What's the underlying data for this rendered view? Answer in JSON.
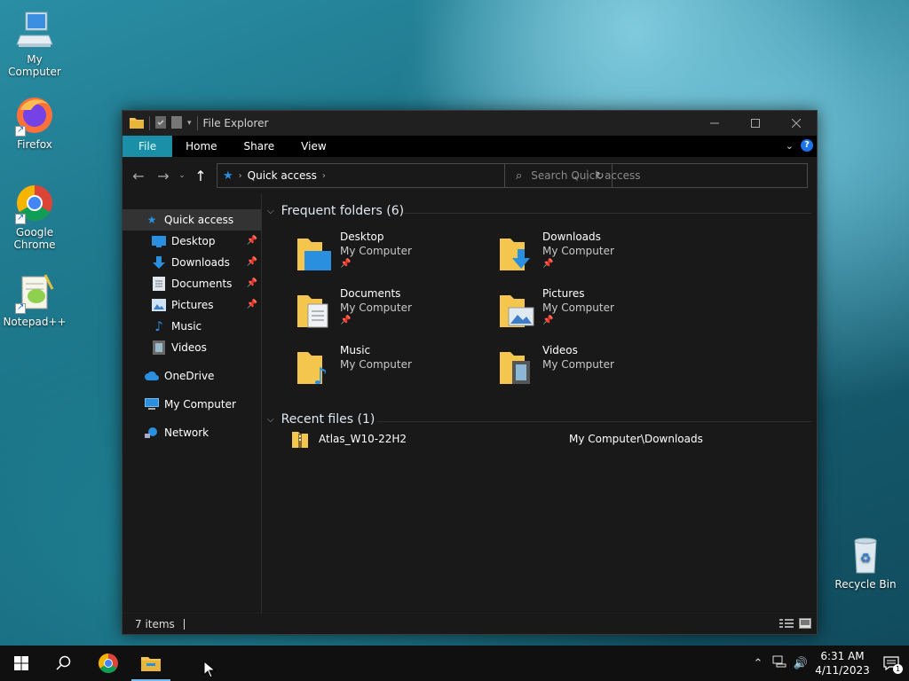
{
  "desktop": {
    "icons": [
      {
        "label": "My Computer"
      },
      {
        "label": "Firefox"
      },
      {
        "label": "Google Chrome"
      },
      {
        "label": "Notepad++"
      },
      {
        "label": "Recycle Bin"
      }
    ]
  },
  "window": {
    "title": "File Explorer",
    "tabs": [
      "File",
      "Home",
      "Share",
      "View"
    ],
    "address": {
      "crumb": "Quick access"
    },
    "search_placeholder": "Search Quick access",
    "nav": {
      "items": [
        {
          "label": "Quick access",
          "icon": "star-icon"
        },
        {
          "label": "Desktop",
          "icon": "desktop-folder-icon",
          "pinned": true
        },
        {
          "label": "Downloads",
          "icon": "download-arrow-icon",
          "pinned": true
        },
        {
          "label": "Documents",
          "icon": "documents-icon",
          "pinned": true
        },
        {
          "label": "Pictures",
          "icon": "pictures-icon",
          "pinned": true
        },
        {
          "label": "Music",
          "icon": "music-note-icon"
        },
        {
          "label": "Videos",
          "icon": "video-icon"
        },
        {
          "label": "OneDrive",
          "icon": "cloud-icon"
        },
        {
          "label": "My Computer",
          "icon": "computer-icon"
        },
        {
          "label": "Network",
          "icon": "network-icon"
        }
      ]
    },
    "frequent": {
      "header": "Frequent folders (6)",
      "folders": [
        {
          "name": "Desktop",
          "location": "My Computer",
          "pinned": true
        },
        {
          "name": "Downloads",
          "location": "My Computer",
          "pinned": true
        },
        {
          "name": "Documents",
          "location": "My Computer",
          "pinned": true
        },
        {
          "name": "Pictures",
          "location": "My Computer",
          "pinned": true
        },
        {
          "name": "Music",
          "location": "My Computer",
          "pinned": false
        },
        {
          "name": "Videos",
          "location": "My Computer",
          "pinned": false
        }
      ]
    },
    "recent": {
      "header": "Recent files (1)",
      "files": [
        {
          "name": "Atlas_W10-22H2",
          "path": "My Computer\\Downloads"
        }
      ]
    },
    "status": {
      "items": "7 items"
    }
  },
  "taskbar": {
    "time": "6:31 AM",
    "date": "4/11/2023",
    "notification_count": "1"
  },
  "colors": {
    "accent_tab": "#1b8ea8",
    "folder_yellow": "#f4c64d",
    "window_bg": "#191919"
  }
}
